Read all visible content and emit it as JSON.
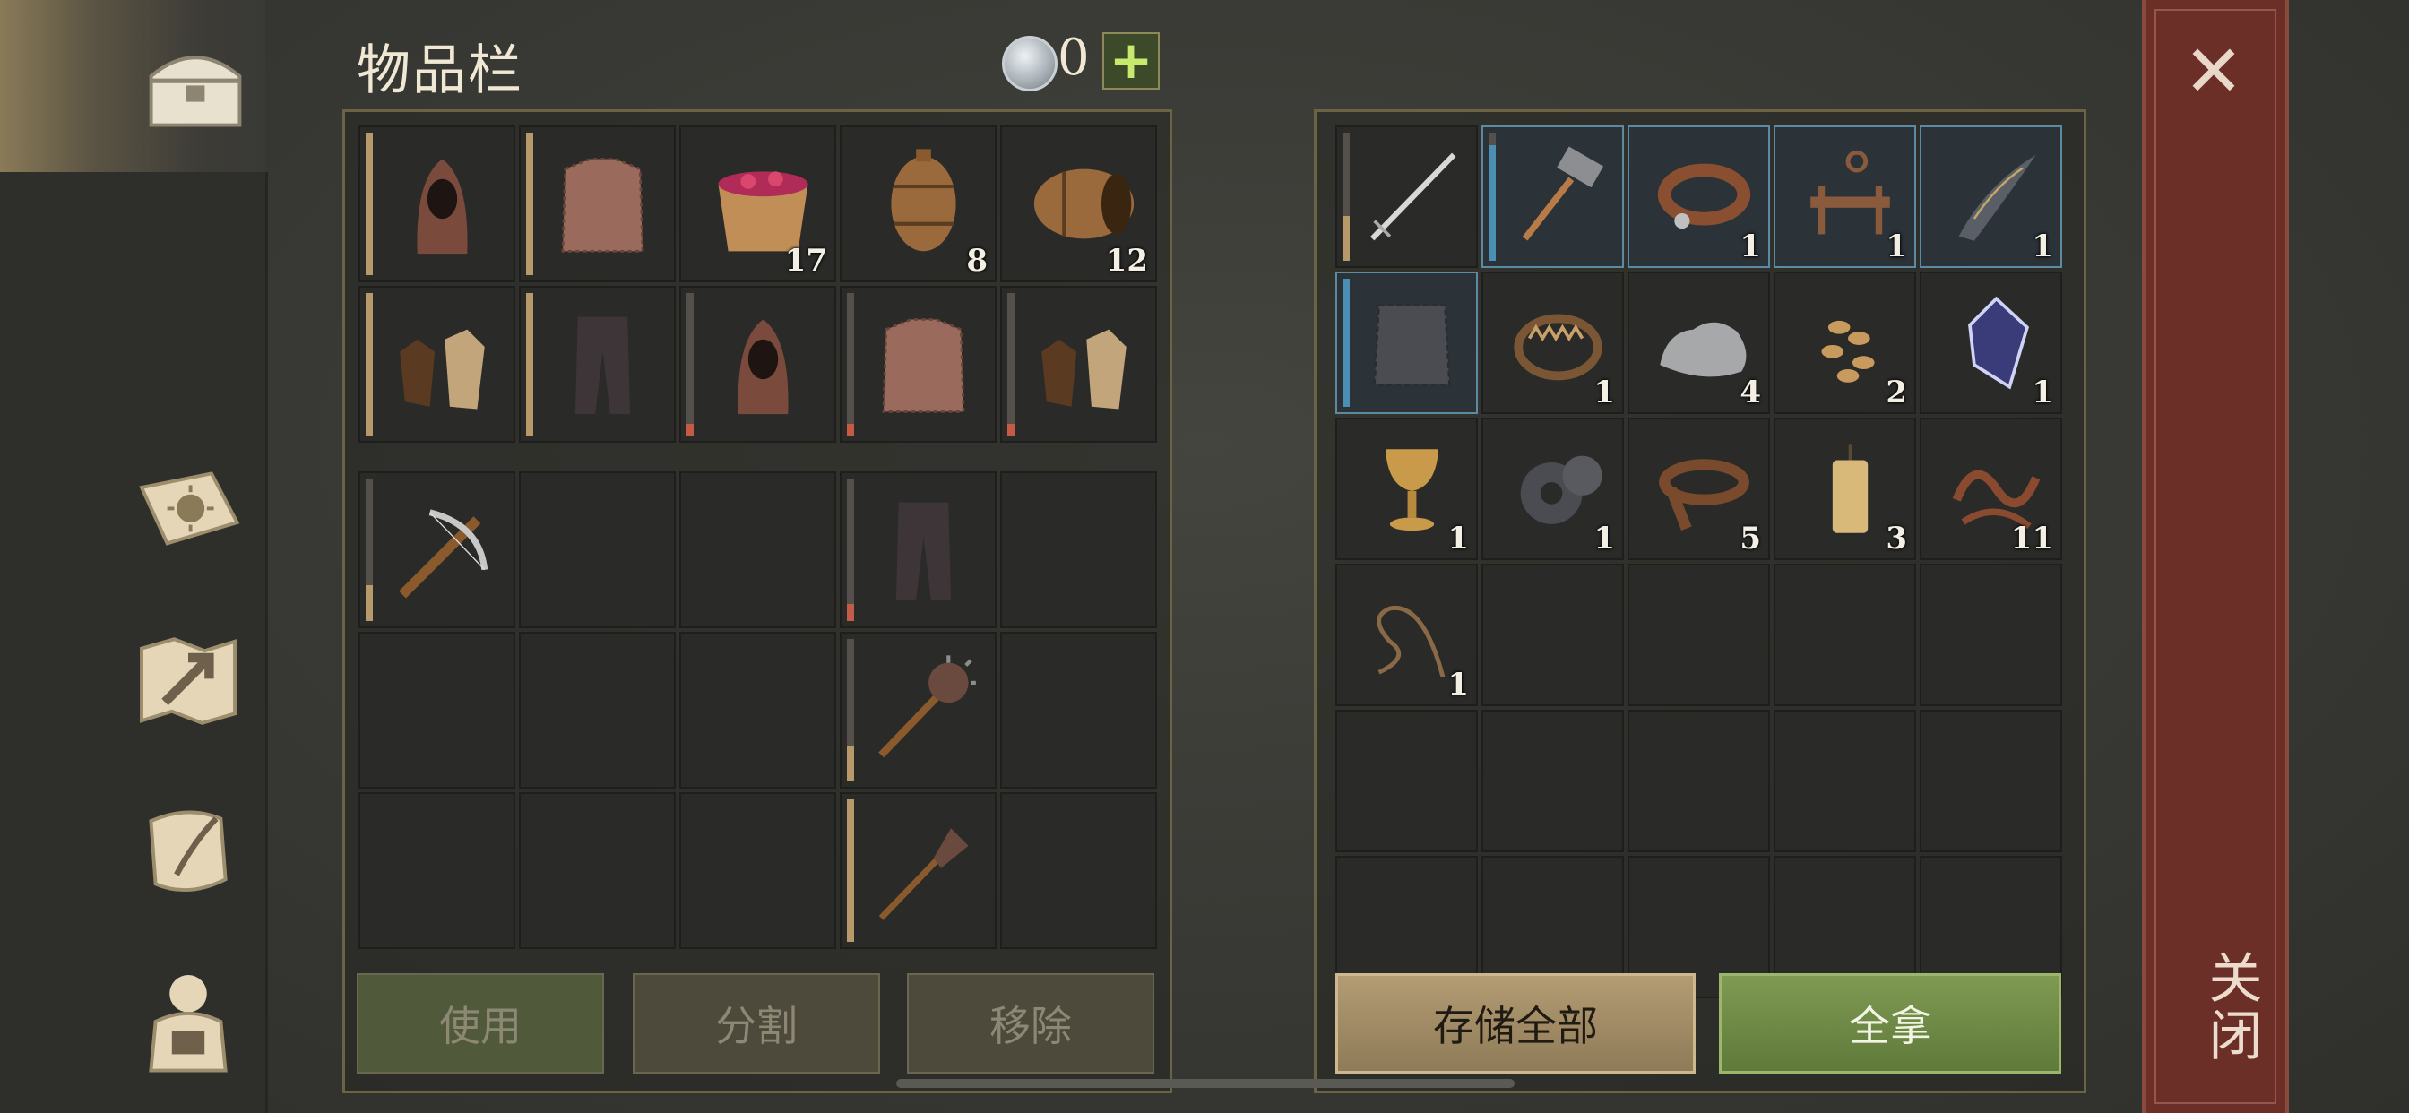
{
  "header": {
    "title": "物品栏",
    "coins": "0",
    "plus": "+"
  },
  "colors": {
    "accent_store": "#b39c74",
    "accent_take": "#7f9a52",
    "close_bar": "#6b2f28"
  },
  "nav": [
    {
      "name": "chest-icon"
    },
    {
      "name": "sun-book-icon"
    },
    {
      "name": "map-arrow-icon"
    },
    {
      "name": "scroll-quill-icon"
    },
    {
      "name": "character-backpack-icon"
    }
  ],
  "inventory": {
    "equipped": [
      {
        "icon": "hood-icon",
        "qty": "",
        "durability": 1.0,
        "bar": "#b89a6a"
      },
      {
        "icon": "chainmail-icon",
        "qty": "",
        "durability": 1.0,
        "bar": "#b89a6a"
      },
      {
        "icon": "berry-bucket-icon",
        "qty": "17"
      },
      {
        "icon": "barrel-upright-icon",
        "qty": "8"
      },
      {
        "icon": "barrel-side-icon",
        "qty": "12"
      },
      {
        "icon": "gloves-icon",
        "qty": "",
        "durability": 1.0,
        "bar": "#b89a6a"
      },
      {
        "icon": "pants-icon",
        "qty": "",
        "durability": 1.0,
        "bar": "#b89a6a"
      },
      {
        "icon": "hood-icon",
        "qty": "",
        "durability": 0.08,
        "bar": "#c45b47"
      },
      {
        "icon": "chainmail-icon",
        "qty": "",
        "durability": 0.08,
        "bar": "#c45b47"
      },
      {
        "icon": "gloves-icon",
        "qty": "",
        "durability": 0.08,
        "bar": "#c45b47"
      }
    ],
    "backpack": [
      {
        "icon": "crossbow-icon",
        "qty": "",
        "durability": 0.25,
        "bar": "#b89a6a"
      },
      {
        "icon": "",
        "qty": ""
      },
      {
        "icon": "",
        "qty": ""
      },
      {
        "icon": "pants-icon",
        "qty": "",
        "durability": 0.12,
        "bar": "#c45b47"
      },
      {
        "icon": "",
        "qty": ""
      },
      {
        "icon": "",
        "qty": ""
      },
      {
        "icon": "",
        "qty": ""
      },
      {
        "icon": "",
        "qty": ""
      },
      {
        "icon": "mace-icon",
        "qty": "",
        "durability": 0.25,
        "bar": "#b89a6a"
      },
      {
        "icon": "",
        "qty": ""
      },
      {
        "icon": "",
        "qty": ""
      },
      {
        "icon": "",
        "qty": ""
      },
      {
        "icon": "",
        "qty": ""
      },
      {
        "icon": "spiked-mace-icon",
        "qty": "",
        "durability": 1.0,
        "bar": "#b89a6a"
      },
      {
        "icon": "",
        "qty": ""
      }
    ],
    "buttons": {
      "use": "使用",
      "split": "分割",
      "remove": "移除"
    }
  },
  "storage": {
    "items": [
      {
        "icon": "sword-icon",
        "qty": "",
        "durability": 0.35,
        "bar": "#b89a6a"
      },
      {
        "icon": "hammer-icon",
        "qty": "",
        "durability": 0.9,
        "bar": "#4c8fb5",
        "selected": true
      },
      {
        "icon": "collar-icon",
        "qty": "1",
        "selected": true
      },
      {
        "icon": "key-rack-icon",
        "qty": "1",
        "selected": true
      },
      {
        "icon": "blade-fragment-icon",
        "qty": "1",
        "selected": true
      },
      {
        "icon": "scale-armor-icon",
        "qty": "",
        "durability": 1.0,
        "bar": "#4c8fb5",
        "selected": true
      },
      {
        "icon": "bear-trap-icon",
        "qty": "1"
      },
      {
        "icon": "stone-icon",
        "qty": "4"
      },
      {
        "icon": "seeds-icon",
        "qty": "2"
      },
      {
        "icon": "crystal-icon",
        "qty": "1"
      },
      {
        "icon": "goblet-icon",
        "qty": "1"
      },
      {
        "icon": "gear-icon",
        "qty": "1"
      },
      {
        "icon": "leather-strap-icon",
        "qty": "5"
      },
      {
        "icon": "candle-icon",
        "qty": "3"
      },
      {
        "icon": "rope-scraps-icon",
        "qty": "11"
      },
      {
        "icon": "whip-icon",
        "qty": "1"
      },
      {
        "icon": "",
        "qty": ""
      },
      {
        "icon": "",
        "qty": ""
      },
      {
        "icon": "",
        "qty": ""
      },
      {
        "icon": "",
        "qty": ""
      },
      {
        "icon": "",
        "qty": ""
      },
      {
        "icon": "",
        "qty": ""
      },
      {
        "icon": "",
        "qty": ""
      },
      {
        "icon": "",
        "qty": ""
      },
      {
        "icon": "",
        "qty": ""
      },
      {
        "icon": "",
        "qty": ""
      },
      {
        "icon": "",
        "qty": ""
      },
      {
        "icon": "",
        "qty": ""
      },
      {
        "icon": "",
        "qty": ""
      },
      {
        "icon": "",
        "qty": ""
      }
    ],
    "buttons": {
      "store_all": "存储全部",
      "take_all": "全拿"
    }
  },
  "close": {
    "label": "关闭",
    "x": "✕"
  }
}
